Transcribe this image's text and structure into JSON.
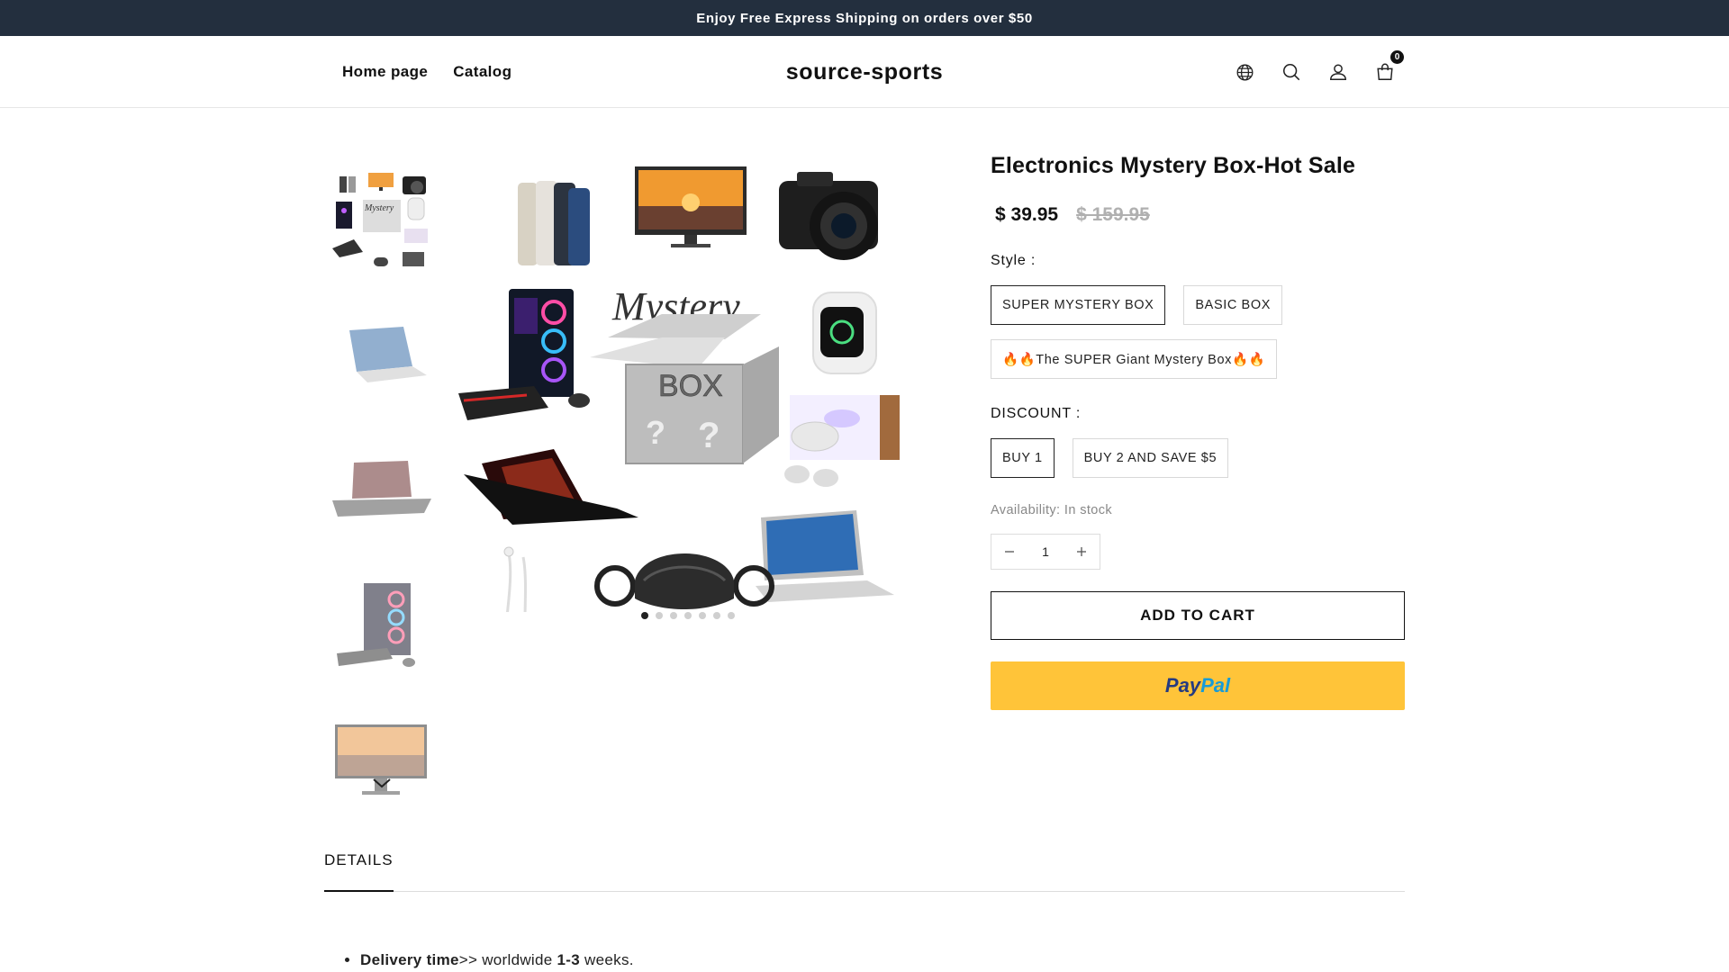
{
  "announcement": "Enjoy Free Express Shipping on orders over $50",
  "header": {
    "nav": [
      "Home page",
      "Catalog"
    ],
    "logo": "source-sports",
    "cart_count": "0",
    "icons": [
      "globe-icon",
      "search-icon",
      "account-icon",
      "cart-icon"
    ]
  },
  "gallery": {
    "thumbnails": [
      "mystery-box-collage",
      "laptop",
      "gaming-laptop",
      "gaming-pc",
      "monitor"
    ],
    "slide_count": 7,
    "active_slide": 1
  },
  "product": {
    "title": "Electronics Mystery Box-Hot Sale",
    "price": "$ 39.95",
    "compare_price": "$ 159.95",
    "style_label": "Style :",
    "styles": [
      "SUPER MYSTERY BOX",
      "BASIC BOX",
      "🔥🔥The SUPER Giant Mystery Box🔥🔥"
    ],
    "discount_label": "DISCOUNT :",
    "discounts": [
      "BUY 1",
      "BUY 2 AND SAVE $5"
    ],
    "availability": "Availability: In stock",
    "quantity": "1",
    "add_to_cart": "ADD TO CART",
    "paypal_a": "Pay",
    "paypal_b": "Pal"
  },
  "tabs": {
    "details": "DETAILS"
  },
  "details": {
    "delivery_bold": "Delivery time",
    "delivery_mid": ">> worldwide ",
    "delivery_weeks": "1-3",
    "delivery_end": " weeks."
  },
  "colors": {
    "announce_bg": "#232f3e",
    "paypal": "#ffc439",
    "accent": "#111111"
  }
}
